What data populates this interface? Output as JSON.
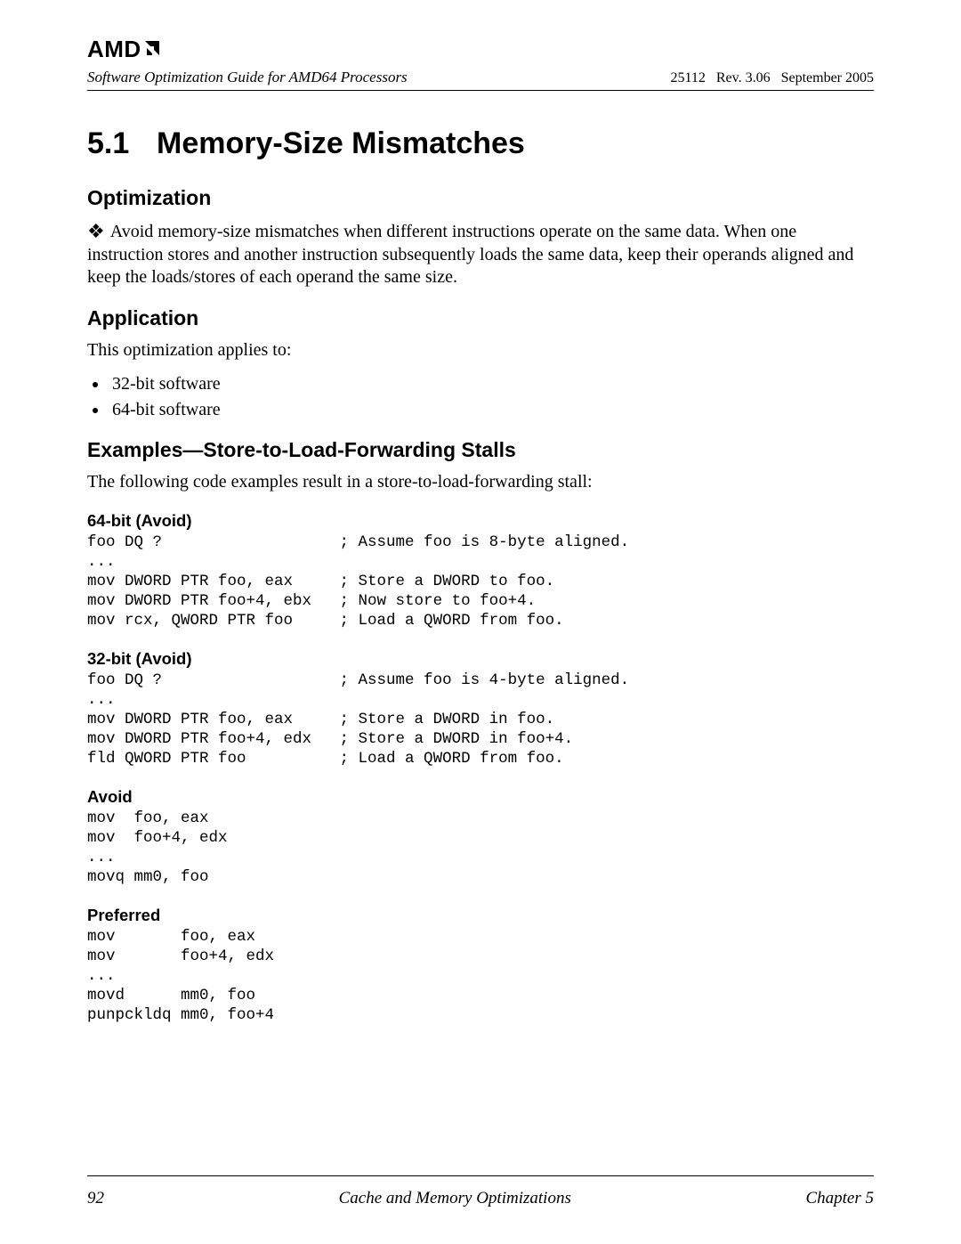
{
  "header": {
    "logo_text": "AMD",
    "doc_title": "Software Optimization Guide for AMD64 Processors",
    "doc_meta": "25112   Rev. 3.06   September 2005"
  },
  "section": {
    "number": "5.1",
    "title": "Memory-Size Mismatches"
  },
  "optimization": {
    "heading": "Optimization",
    "text": "Avoid memory-size mismatches when different instructions operate on the same data. When one instruction stores and another instruction subsequently loads the same data, keep their operands aligned and keep the loads/stores of each operand the same size."
  },
  "application": {
    "heading": "Application",
    "intro": "This optimization applies to:",
    "items": [
      "32-bit software",
      "64-bit software"
    ]
  },
  "examples": {
    "heading": "Examples—Store-to-Load-Forwarding Stalls",
    "intro": "The following code examples result in a store-to-load-forwarding stall:",
    "blocks": [
      {
        "title": "64-bit (Avoid)",
        "code": "foo DQ ?                   ; Assume foo is 8-byte aligned.\n...\nmov DWORD PTR foo, eax     ; Store a DWORD to foo.\nmov DWORD PTR foo+4, ebx   ; Now store to foo+4.\nmov rcx, QWORD PTR foo     ; Load a QWORD from foo."
      },
      {
        "title": "32-bit (Avoid)",
        "code": "foo DQ ?                   ; Assume foo is 4-byte aligned.\n...\nmov DWORD PTR foo, eax     ; Store a DWORD in foo.\nmov DWORD PTR foo+4, edx   ; Store a DWORD in foo+4.\nfld QWORD PTR foo          ; Load a QWORD from foo."
      },
      {
        "title": "Avoid",
        "code": "mov  foo, eax\nmov  foo+4, edx\n...\nmovq mm0, foo"
      },
      {
        "title": "Preferred",
        "code": "mov       foo, eax\nmov       foo+4, edx\n...\nmovd      mm0, foo\npunpckldq mm0, foo+4"
      }
    ]
  },
  "footer": {
    "page_number": "92",
    "center": "Cache and Memory Optimizations",
    "right": "Chapter 5"
  }
}
